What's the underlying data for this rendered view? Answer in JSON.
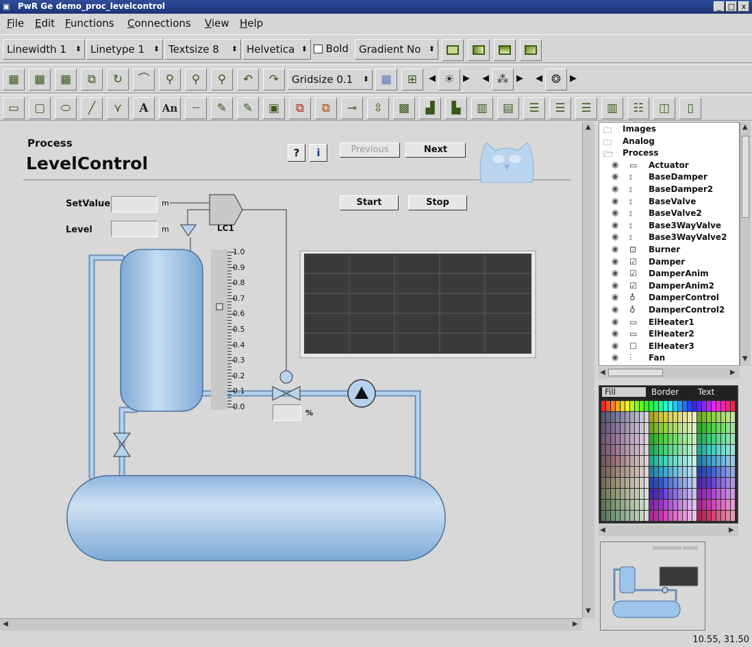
{
  "window": {
    "title": "PwR Ge  demo_proc_levelcontrol",
    "logo": "PwR",
    "min": "_",
    "max": "□",
    "close": "x"
  },
  "menu": [
    "File",
    "Edit",
    "Functions",
    "Connections",
    "View",
    "Help"
  ],
  "toolbar1": {
    "linewidth": "Linewidth 1",
    "linetype": "Linetype 1",
    "textsize": "Textsize 8",
    "font": "Helvetica",
    "bold_label": "Bold",
    "gradient": "Gradient No"
  },
  "toolbar2": {
    "gridsize": "Gridsize 0.1"
  },
  "toolbar3": {
    "text_tool": "A",
    "annotation_tool": "An"
  },
  "graph": {
    "group_title": "Process",
    "title": "LevelControl",
    "help_button": "?",
    "info_button": "i",
    "previous_button": "Previous",
    "next_button": "Next",
    "start_button": "Start",
    "stop_button": "Stop",
    "setvalue_label": "SetValue",
    "setvalue_unit": "m",
    "level_label": "Level",
    "level_unit": "m",
    "controller_label": "LC1",
    "valve_unit": "%",
    "scale_ticks": [
      "1.0",
      "0.9",
      "0.8",
      "0.7",
      "0.6",
      "0.5",
      "0.4",
      "0.3",
      "0.2",
      "0.1",
      "0.0"
    ]
  },
  "tree": {
    "items": [
      {
        "label": "Images",
        "icon": "folder-icon",
        "indent": 0
      },
      {
        "label": "Analog",
        "icon": "folder-icon",
        "indent": 0
      },
      {
        "label": "Process",
        "icon": "folder-open-icon",
        "indent": 0
      },
      {
        "label": "Actuator",
        "icon": "actuator-icon",
        "indent": 1
      },
      {
        "label": "BaseDamper",
        "icon": "damper-icon",
        "indent": 1
      },
      {
        "label": "BaseDamper2",
        "icon": "damper-icon",
        "indent": 1
      },
      {
        "label": "BaseValve",
        "icon": "valve-icon",
        "indent": 1
      },
      {
        "label": "BaseValve2",
        "icon": "valve-icon",
        "indent": 1
      },
      {
        "label": "Base3WayValve",
        "icon": "valve-icon",
        "indent": 1
      },
      {
        "label": "Base3WayValve2",
        "icon": "valve-icon",
        "indent": 1
      },
      {
        "label": "Burner",
        "icon": "burner-icon",
        "indent": 1
      },
      {
        "label": "Damper",
        "icon": "checkbox-icon",
        "indent": 1
      },
      {
        "label": "DamperAnim",
        "icon": "checkbox-icon",
        "indent": 1
      },
      {
        "label": "DamperAnim2",
        "icon": "checkbox-icon",
        "indent": 1
      },
      {
        "label": "DamperControl",
        "icon": "control-icon",
        "indent": 1
      },
      {
        "label": "DamperControl2",
        "icon": "control-icon",
        "indent": 1
      },
      {
        "label": "ElHeater1",
        "icon": "heater-icon",
        "indent": 1
      },
      {
        "label": "ElHeater2",
        "icon": "heater-icon",
        "indent": 1
      },
      {
        "label": "ElHeater3",
        "icon": "square-icon",
        "indent": 1
      },
      {
        "label": "Fan",
        "icon": "fan-icon",
        "indent": 1
      }
    ]
  },
  "palette": {
    "tabs": [
      "Fill",
      "Border",
      "Text"
    ]
  },
  "status": {
    "coordinates": "10.55, 31.50"
  },
  "colors": {
    "tank": "#9dc4ea",
    "pipe": "#a9c9ea",
    "trend_bg": "#3a3a3a",
    "titlebar": "#1d3478"
  }
}
